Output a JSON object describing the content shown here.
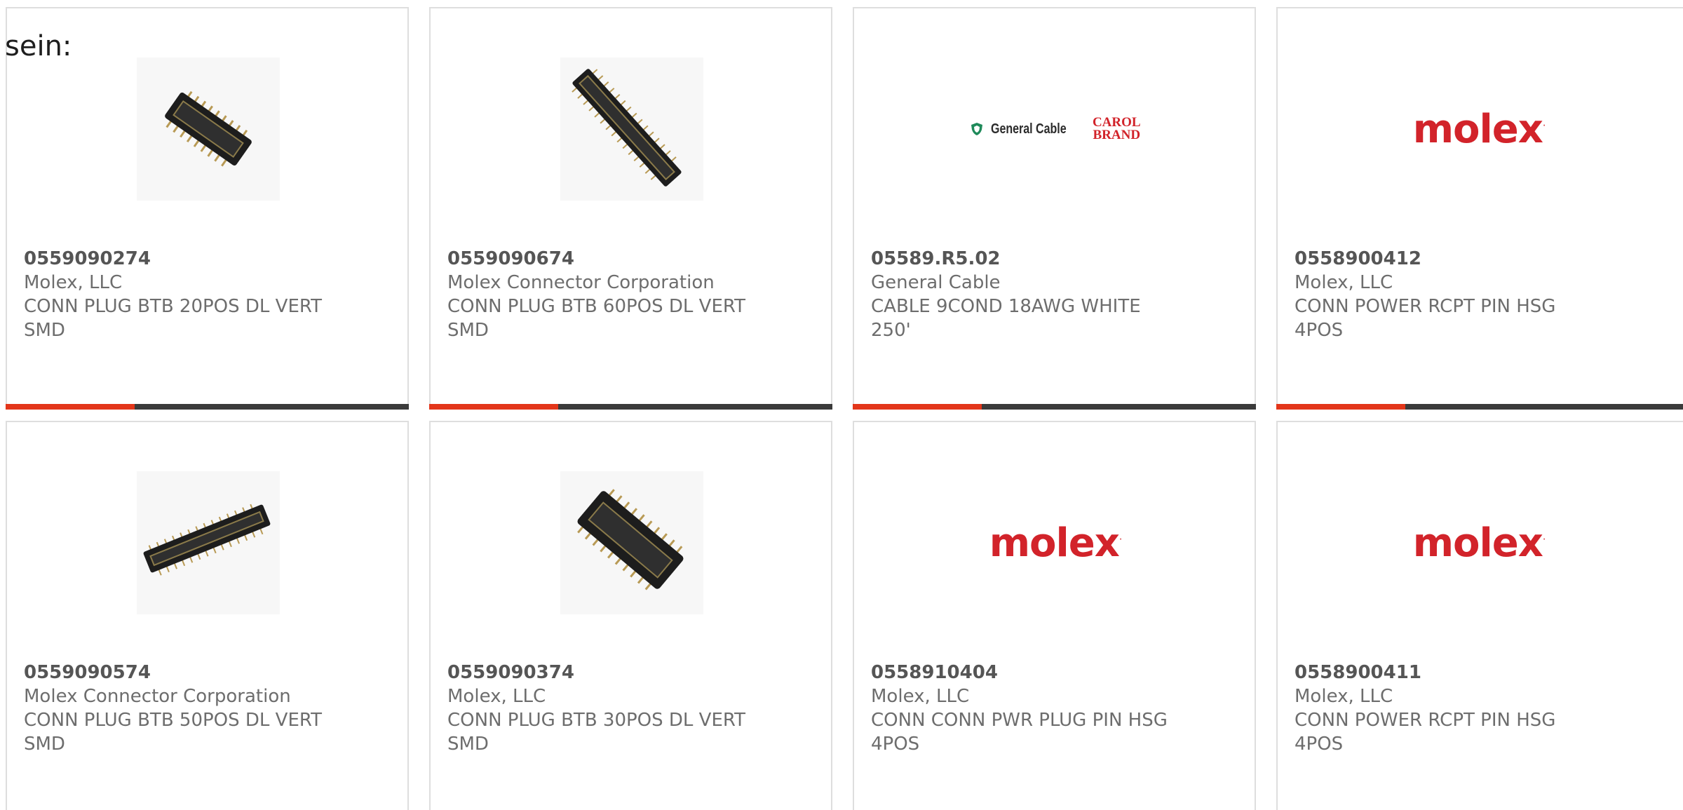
{
  "intro_text": "sein:",
  "products": [
    {
      "part_number": "0559090274",
      "manufacturer": "Molex, LLC",
      "desc_line1": "CONN PLUG BTB 20POS DL VERT",
      "desc_line2": "SMD",
      "image": "connector-20pos-photo",
      "show_bar": true
    },
    {
      "part_number": "0559090674",
      "manufacturer": "Molex Connector Corporation",
      "desc_line1": "CONN PLUG BTB 60POS DL VERT",
      "desc_line2": "SMD",
      "image": "connector-60pos-photo",
      "show_bar": true
    },
    {
      "part_number": "05589.R5.02",
      "manufacturer": "General Cable",
      "desc_line1": "CABLE 9COND 18AWG WHITE",
      "desc_line2": "250'",
      "image": "general-cable-logo",
      "logo_text": "General Cable",
      "logo_text2": "CAROL",
      "logo_text3": "BRAND",
      "show_bar": true
    },
    {
      "part_number": "0558900412",
      "manufacturer": "Molex, LLC",
      "desc_line1": "CONN POWER RCPT PIN HSG",
      "desc_line2": "4POS",
      "image": "molex-logo",
      "logo_text": "molex",
      "show_bar": true
    },
    {
      "part_number": "0559090574",
      "manufacturer": "Molex Connector Corporation",
      "desc_line1": "CONN PLUG BTB 50POS DL VERT",
      "desc_line2": "SMD",
      "image": "connector-50pos-photo",
      "show_bar": false
    },
    {
      "part_number": "0559090374",
      "manufacturer": "Molex, LLC",
      "desc_line1": "CONN PLUG BTB 30POS DL VERT",
      "desc_line2": "SMD",
      "image": "connector-30pos-photo",
      "show_bar": false
    },
    {
      "part_number": "0558910404",
      "manufacturer": "Molex, LLC",
      "desc_line1": "CONN CONN PWR PLUG PIN HSG",
      "desc_line2": "4POS",
      "image": "molex-logo",
      "logo_text": "molex",
      "show_bar": false
    },
    {
      "part_number": "0558900411",
      "manufacturer": "Molex, LLC",
      "desc_line1": "CONN POWER RCPT PIN HSG",
      "desc_line2": "4POS",
      "image": "molex-logo",
      "logo_text": "molex",
      "show_bar": false
    }
  ],
  "colors": {
    "accent": "#e3361a",
    "bar_dark": "#3b3b3b",
    "molex_red": "#d2232a",
    "text_gray": "#6d6d6d",
    "border": "#dedede"
  }
}
